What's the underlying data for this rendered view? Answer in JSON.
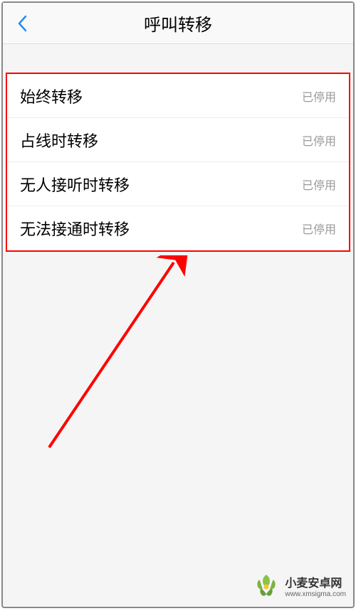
{
  "header": {
    "title": "呼叫转移"
  },
  "items": [
    {
      "label": "始终转移",
      "status": "已停用"
    },
    {
      "label": "占线时转移",
      "status": "已停用"
    },
    {
      "label": "无人接听时转移",
      "status": "已停用"
    },
    {
      "label": "无法接通时转移",
      "status": "已停用"
    }
  ],
  "watermark": {
    "title": "小麦安卓网",
    "url": "www.xmsigma.com"
  }
}
